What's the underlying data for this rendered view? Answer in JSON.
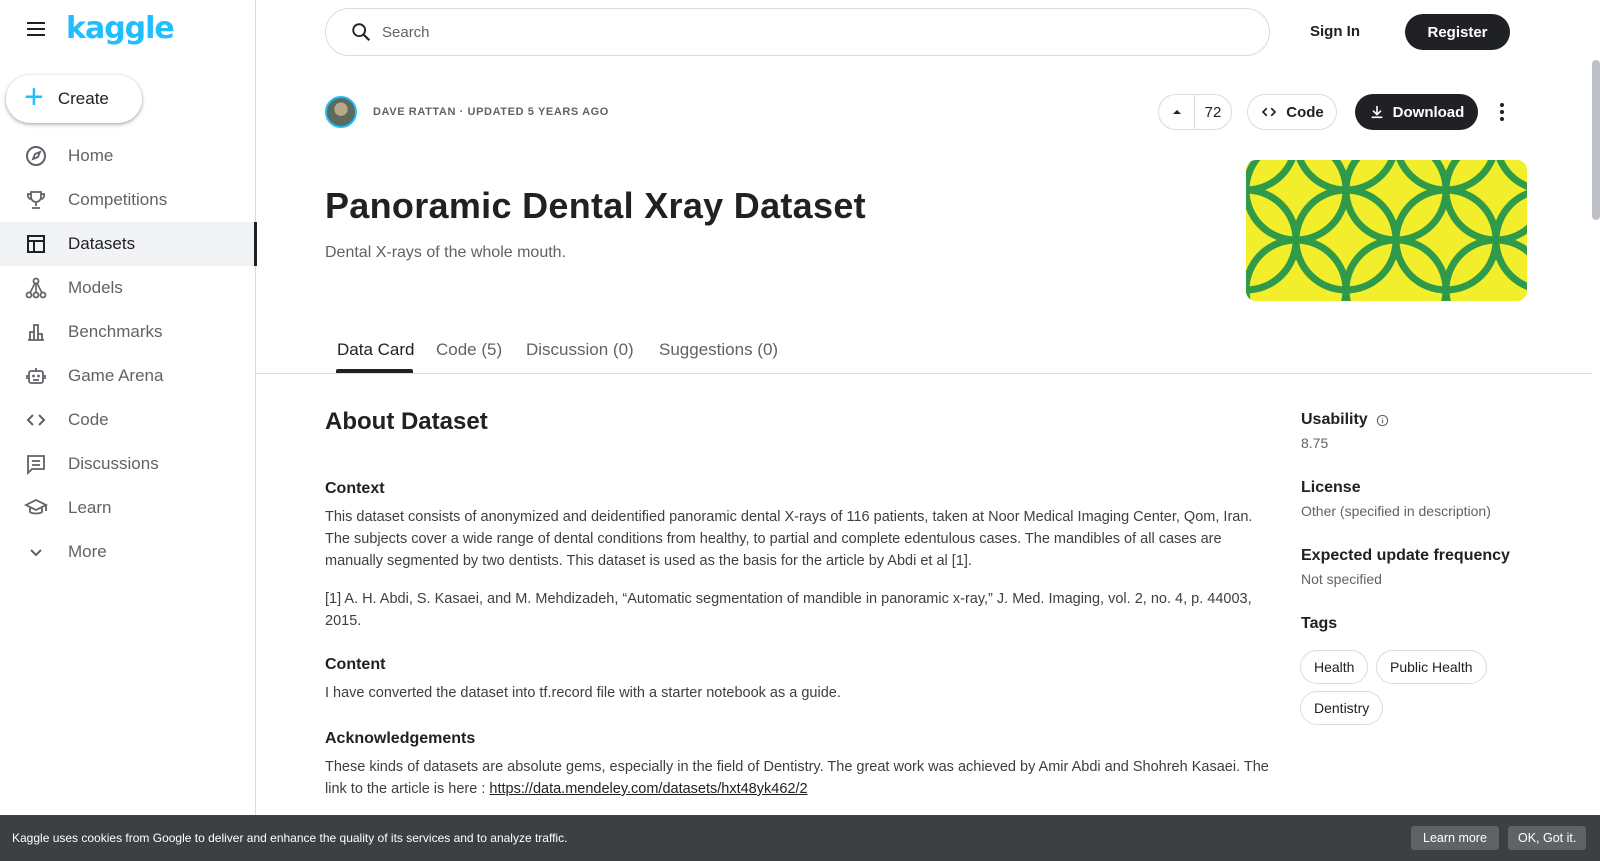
{
  "brand": {
    "logo": "kaggle"
  },
  "create": {
    "label": "Create"
  },
  "nav": {
    "items": [
      {
        "label": "Home"
      },
      {
        "label": "Competitions"
      },
      {
        "label": "Datasets"
      },
      {
        "label": "Models"
      },
      {
        "label": "Benchmarks"
      },
      {
        "label": "Game Arena"
      },
      {
        "label": "Code"
      },
      {
        "label": "Discussions"
      },
      {
        "label": "Learn"
      },
      {
        "label": "More"
      }
    ],
    "active": "Datasets"
  },
  "header": {
    "search_placeholder": "Search",
    "signin": "Sign In",
    "register": "Register"
  },
  "dataset": {
    "byline": "DAVE RATTAN · UPDATED 5 YEARS AGO",
    "votes": "72",
    "code_label": "Code",
    "download_label": "Download",
    "title": "Panoramic Dental Xray Dataset",
    "subtitle": "Dental X-rays of the whole mouth.",
    "cover_colors": {
      "background": "#f2ee2c",
      "pattern": "#2f9a4a"
    }
  },
  "tabs": [
    {
      "label": "Data Card"
    },
    {
      "label": "Code (5)"
    },
    {
      "label": "Discussion (0)"
    },
    {
      "label": "Suggestions (0)"
    }
  ],
  "about": {
    "heading": "About Dataset",
    "context_heading": "Context",
    "context_text": "This dataset consists of anonymized and deidentified panoramic dental X-rays of 116 patients, taken at Noor Medical Imaging Center, Qom, Iran. The subjects cover a wide range of dental conditions from healthy, to partial and complete edentulous cases. The mandibles of all cases are manually segmented by two dentists. This dataset is used as the basis for the article by Abdi et al [1].",
    "reference_text": "[1] A. H. Abdi, S. Kasaei, and M. Mehdizadeh, “Automatic segmentation of mandible in panoramic x-ray,” J. Med. Imaging, vol. 2, no. 4, p. 44003, 2015.",
    "content_heading": "Content",
    "content_text": "I have converted the dataset into tf.record file with a starter notebook as a guide.",
    "ack_heading": "Acknowledgements",
    "ack_text": "These kinds of datasets are absolute gems, especially in the field of Dentistry. The great work was achieved by Amir Abdi and Shohreh Kasaei. The link to the article is here : ",
    "ack_link": "https://data.mendeley.com/datasets/hxt48yk462/2"
  },
  "meta": {
    "usability_label": "Usability",
    "usability_value": "8.75",
    "license_label": "License",
    "license_value": "Other (specified in description)",
    "frequency_label": "Expected update frequency",
    "frequency_value": "Not specified",
    "tags_label": "Tags",
    "tags": [
      "Health",
      "Public Health",
      "Dentistry"
    ]
  },
  "cookie": {
    "text": "Kaggle uses cookies from Google to deliver and enhance the quality of its services and to analyze traffic.",
    "learn_more": "Learn more",
    "ok": "OK, Got it."
  }
}
